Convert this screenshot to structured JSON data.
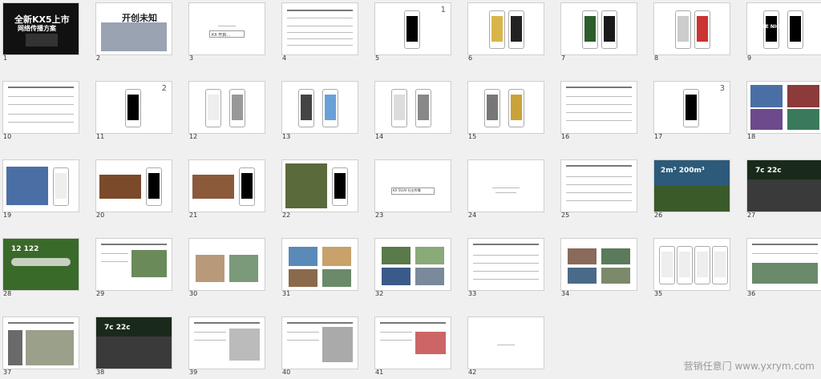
{
  "slides": [
    {
      "num": "1",
      "title": "全新KX5上市",
      "subtitle": "网络传播方案"
    },
    {
      "num": "2",
      "title": "开创未知"
    },
    {
      "num": "3",
      "label": "KX 开启..."
    },
    {
      "num": "4",
      "label": "..."
    },
    {
      "num": "5",
      "label": "1"
    },
    {
      "num": "6"
    },
    {
      "num": "7"
    },
    {
      "num": "8"
    },
    {
      "num": "9",
      "label": "BE NICE"
    },
    {
      "num": "10"
    },
    {
      "num": "11",
      "label": "2"
    },
    {
      "num": "12"
    },
    {
      "num": "13"
    },
    {
      "num": "14"
    },
    {
      "num": "15"
    },
    {
      "num": "16"
    },
    {
      "num": "17",
      "label": "3"
    },
    {
      "num": "18"
    },
    {
      "num": "19"
    },
    {
      "num": "20"
    },
    {
      "num": "21"
    },
    {
      "num": "22"
    },
    {
      "num": "23",
      "label": "KX 5SUV 社交传播"
    },
    {
      "num": "24"
    },
    {
      "num": "25"
    },
    {
      "num": "26",
      "label": "2m³ 200m³"
    },
    {
      "num": "27",
      "label": "7c 22c"
    },
    {
      "num": "28",
      "label": "12 122"
    },
    {
      "num": "29"
    },
    {
      "num": "30"
    },
    {
      "num": "31"
    },
    {
      "num": "32"
    },
    {
      "num": "33"
    },
    {
      "num": "34"
    },
    {
      "num": "35"
    },
    {
      "num": "36"
    },
    {
      "num": "37"
    },
    {
      "num": "38",
      "label": "7c 22c"
    },
    {
      "num": "39"
    },
    {
      "num": "40"
    },
    {
      "num": "41"
    },
    {
      "num": "42"
    }
  ],
  "watermark": "营销任意门 www.yxrym.com"
}
